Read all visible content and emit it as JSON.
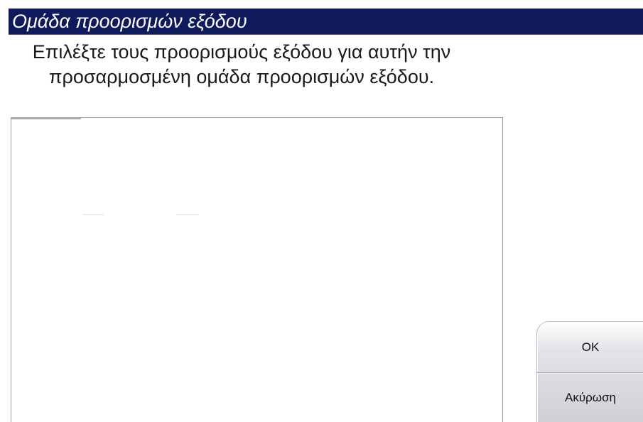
{
  "dialog": {
    "title": "Ομάδα προορισμών εξόδου",
    "instruction": "Επιλέξτε τους προορισμούς εξόδου για αυτήν την προσαρμοσμένη ομάδα προορισμών εξόδου.",
    "destinations": [],
    "buttons": {
      "ok_label": "OK",
      "cancel_label": "Ακύρωση"
    }
  },
  "colors": {
    "title_bar": "#0f1a5c",
    "title_text": "#ffffff",
    "button_face": "#d8d8de"
  }
}
